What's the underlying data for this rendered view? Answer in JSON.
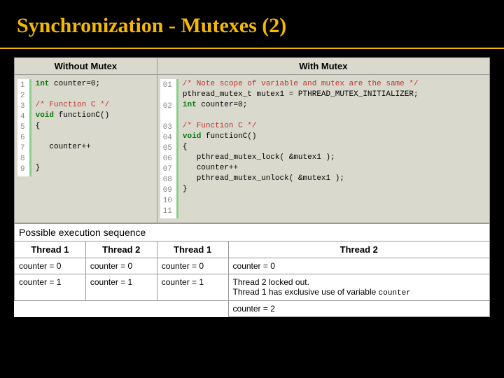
{
  "title": "Synchronization - Mutexes (2)",
  "top": {
    "left_header": "Without Mutex",
    "right_header": "With Mutex",
    "left_gutter": "1\n2\n3\n4\n5\n6\n7\n8\n9",
    "right_gutter": "01\n\n02\n\n03\n04\n05\n06\n07\n08\n09\n10\n11",
    "left_code": {
      "l1a": "int",
      "l1b": " counter=0;",
      "l2": "",
      "l3": "/* Function C */",
      "l4a": "void",
      "l4b": " functionC()",
      "l5": "{",
      "l6": "",
      "l7": "   counter++",
      "l8": "",
      "l9": "}"
    },
    "right_code": {
      "l1": "/* Note scope of variable and mutex are the same */",
      "l2": "pthread_mutex_t mutex1 = PTHREAD_MUTEX_INITIALIZER;",
      "l3a": "int",
      "l3b": " counter=0;",
      "l4": "",
      "l5": "/* Function C */",
      "l6a": "void",
      "l6b": " functionC()",
      "l7": "{",
      "l8": "   pthread_mutex_lock( &mutex1 );",
      "l9": "   counter++",
      "l10": "   pthread_mutex_unlock( &mutex1 );",
      "l11": "}"
    }
  },
  "exec": {
    "header": "Possible execution sequence",
    "cols": {
      "t1a": "Thread 1",
      "t2a": "Thread 2",
      "t1b": "Thread 1",
      "t2b": "Thread 2"
    },
    "rows": [
      {
        "c1": "counter = 0",
        "c2": "counter = 0",
        "c3": "counter = 0",
        "c4": "counter = 0"
      },
      {
        "c1": "counter = 1",
        "c2": "counter = 1",
        "c3": "counter = 1",
        "c4_a": "Thread 2 locked out.\nThread 1 has exclusive use of variable ",
        "c4_b": "counter"
      },
      {
        "c1": "",
        "c2": "",
        "c3": "",
        "c4": "counter = 2"
      }
    ]
  }
}
